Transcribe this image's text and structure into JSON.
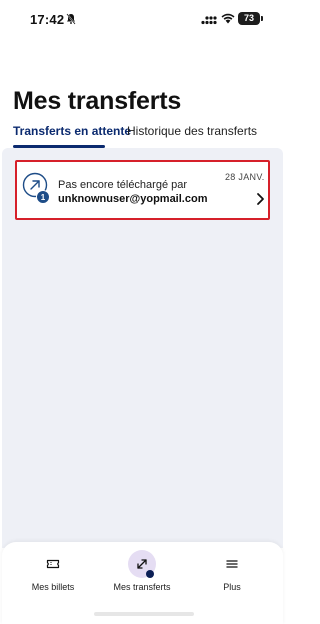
{
  "status_bar": {
    "time": "17:42",
    "battery": "73"
  },
  "header": {
    "title": "Mes transferts"
  },
  "tabs": [
    {
      "label": "Transferts en attente",
      "active": true
    },
    {
      "label": "Historique des transferts",
      "active": false
    }
  ],
  "transfers": [
    {
      "status": "Pas encore téléchargé par",
      "email": "unknownuser@yopmail.com",
      "date": "28 JANV.",
      "badge": "1",
      "icon": "arrow-up-right-icon"
    }
  ],
  "bottom_nav": [
    {
      "label": "Mes billets",
      "icon": "ticket-icon",
      "active": false
    },
    {
      "label": "Mes transferts",
      "icon": "transfer-arrows-icon",
      "active": true
    },
    {
      "label": "Plus",
      "icon": "menu-icon",
      "active": false
    }
  ],
  "colors": {
    "brand": "#0b2a6f",
    "highlight_border": "#d6202a",
    "content_bg": "#eef0f6",
    "active_nav_bg": "#e5ddf3"
  }
}
